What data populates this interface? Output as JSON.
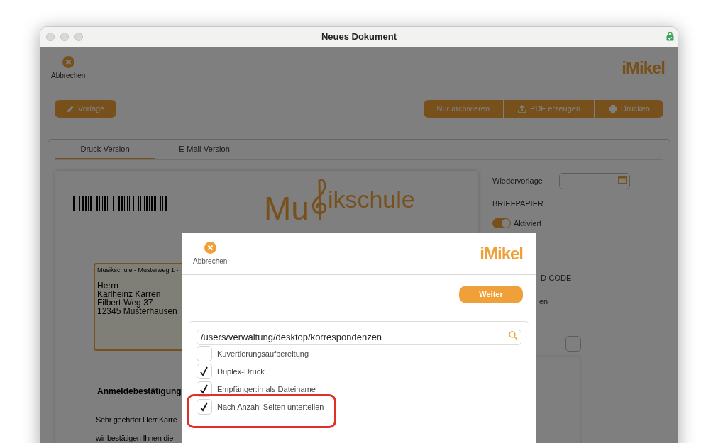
{
  "window": {
    "title": "Neues Dokument"
  },
  "toolbar": {
    "cancel_label": "Abbrechen",
    "logo": "iMikel"
  },
  "actions": {
    "template_button": "Vorlage",
    "buttons": [
      {
        "label": "Nur archivieren",
        "kind": "plain"
      },
      {
        "label": "PDF erzeugen",
        "kind": "upload"
      },
      {
        "label": "Drucken",
        "kind": "print"
      }
    ]
  },
  "tabs": [
    {
      "label": "Druck-Version",
      "selected": true
    },
    {
      "label": "E-Mail-Version",
      "selected": false
    }
  ],
  "letter": {
    "letterhead": [
      "Mu",
      "ikschule"
    ],
    "sender_line": "Musikschule - Musterweg 1 -",
    "address": [
      "Herrn",
      "Karlheinz Karren",
      "Filbert-Weg 37",
      "12345 Musterhausen"
    ],
    "subject": "Anmeldebestätigung",
    "body": [
      "Sehr geehrter Herr Karre",
      "wir bestätigen Ihnen die"
    ]
  },
  "side_panel": {
    "follow_up_label": "Wiedervorlage",
    "stationery_heading": "BRIEFPAPIER",
    "stationery_toggle": {
      "label": "Aktiviert",
      "on": true
    },
    "id_code_heading": "D-CODE",
    "option_fragment": "en",
    "checkbox": {
      "checked": false
    }
  },
  "dialog": {
    "cancel_label": "Abbrechen",
    "logo": "iMikel",
    "next_button": "Weiter",
    "path_field": {
      "value": "/users/verwaltung/desktop/korrespondenzen"
    },
    "options": [
      {
        "label": "Kuvertierungsaufbereitung",
        "checked": false
      },
      {
        "label": "Duplex-Druck",
        "checked": true
      },
      {
        "label": "Empfänger:in als Dateiname",
        "checked": true
      },
      {
        "label": "Nach Anzahl Seiten unterteilen",
        "checked": true
      }
    ]
  }
}
